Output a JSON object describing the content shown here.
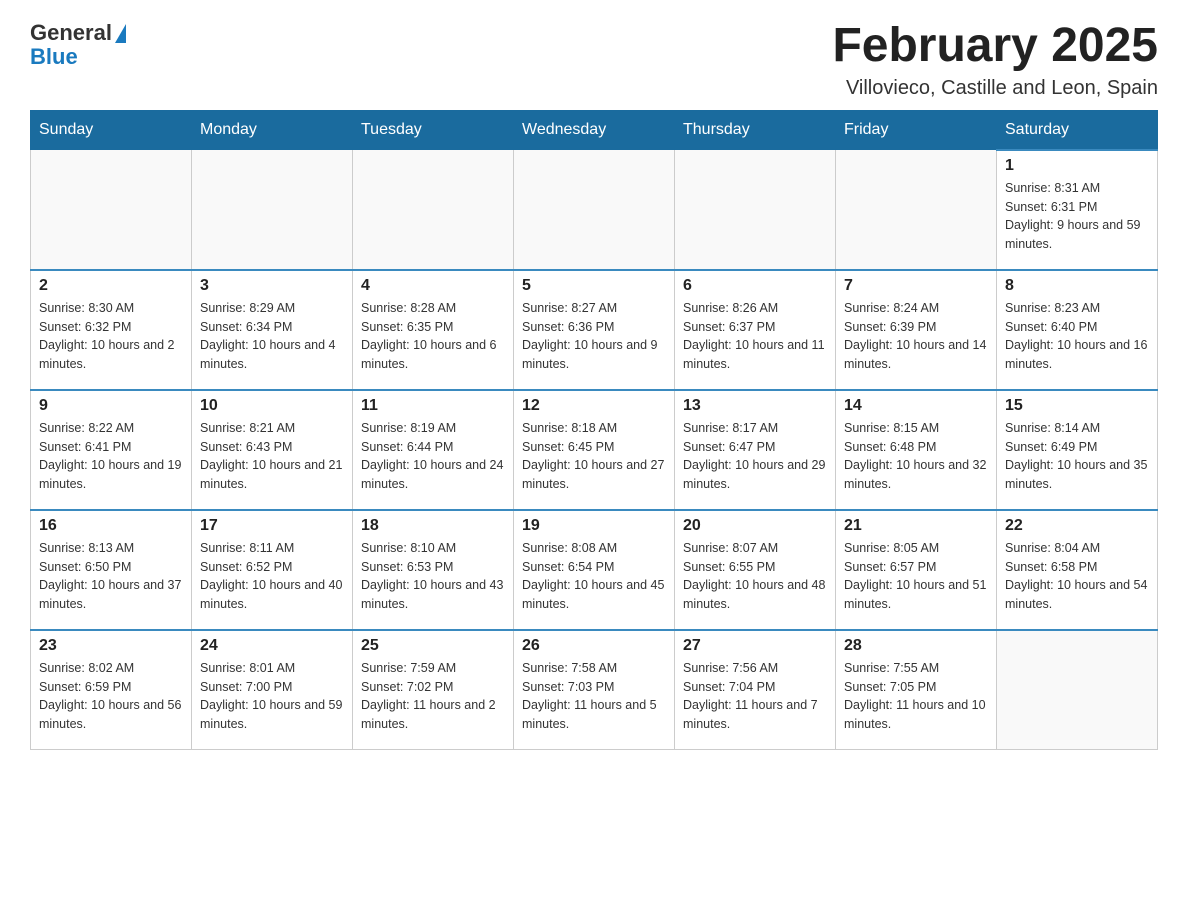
{
  "logo": {
    "text_general": "General",
    "text_blue": "Blue"
  },
  "header": {
    "month_title": "February 2025",
    "location": "Villovieco, Castille and Leon, Spain"
  },
  "days_of_week": [
    "Sunday",
    "Monday",
    "Tuesday",
    "Wednesday",
    "Thursday",
    "Friday",
    "Saturday"
  ],
  "weeks": [
    [
      {
        "day": "",
        "info": ""
      },
      {
        "day": "",
        "info": ""
      },
      {
        "day": "",
        "info": ""
      },
      {
        "day": "",
        "info": ""
      },
      {
        "day": "",
        "info": ""
      },
      {
        "day": "",
        "info": ""
      },
      {
        "day": "1",
        "info": "Sunrise: 8:31 AM\nSunset: 6:31 PM\nDaylight: 9 hours and 59 minutes."
      }
    ],
    [
      {
        "day": "2",
        "info": "Sunrise: 8:30 AM\nSunset: 6:32 PM\nDaylight: 10 hours and 2 minutes."
      },
      {
        "day": "3",
        "info": "Sunrise: 8:29 AM\nSunset: 6:34 PM\nDaylight: 10 hours and 4 minutes."
      },
      {
        "day": "4",
        "info": "Sunrise: 8:28 AM\nSunset: 6:35 PM\nDaylight: 10 hours and 6 minutes."
      },
      {
        "day": "5",
        "info": "Sunrise: 8:27 AM\nSunset: 6:36 PM\nDaylight: 10 hours and 9 minutes."
      },
      {
        "day": "6",
        "info": "Sunrise: 8:26 AM\nSunset: 6:37 PM\nDaylight: 10 hours and 11 minutes."
      },
      {
        "day": "7",
        "info": "Sunrise: 8:24 AM\nSunset: 6:39 PM\nDaylight: 10 hours and 14 minutes."
      },
      {
        "day": "8",
        "info": "Sunrise: 8:23 AM\nSunset: 6:40 PM\nDaylight: 10 hours and 16 minutes."
      }
    ],
    [
      {
        "day": "9",
        "info": "Sunrise: 8:22 AM\nSunset: 6:41 PM\nDaylight: 10 hours and 19 minutes."
      },
      {
        "day": "10",
        "info": "Sunrise: 8:21 AM\nSunset: 6:43 PM\nDaylight: 10 hours and 21 minutes."
      },
      {
        "day": "11",
        "info": "Sunrise: 8:19 AM\nSunset: 6:44 PM\nDaylight: 10 hours and 24 minutes."
      },
      {
        "day": "12",
        "info": "Sunrise: 8:18 AM\nSunset: 6:45 PM\nDaylight: 10 hours and 27 minutes."
      },
      {
        "day": "13",
        "info": "Sunrise: 8:17 AM\nSunset: 6:47 PM\nDaylight: 10 hours and 29 minutes."
      },
      {
        "day": "14",
        "info": "Sunrise: 8:15 AM\nSunset: 6:48 PM\nDaylight: 10 hours and 32 minutes."
      },
      {
        "day": "15",
        "info": "Sunrise: 8:14 AM\nSunset: 6:49 PM\nDaylight: 10 hours and 35 minutes."
      }
    ],
    [
      {
        "day": "16",
        "info": "Sunrise: 8:13 AM\nSunset: 6:50 PM\nDaylight: 10 hours and 37 minutes."
      },
      {
        "day": "17",
        "info": "Sunrise: 8:11 AM\nSunset: 6:52 PM\nDaylight: 10 hours and 40 minutes."
      },
      {
        "day": "18",
        "info": "Sunrise: 8:10 AM\nSunset: 6:53 PM\nDaylight: 10 hours and 43 minutes."
      },
      {
        "day": "19",
        "info": "Sunrise: 8:08 AM\nSunset: 6:54 PM\nDaylight: 10 hours and 45 minutes."
      },
      {
        "day": "20",
        "info": "Sunrise: 8:07 AM\nSunset: 6:55 PM\nDaylight: 10 hours and 48 minutes."
      },
      {
        "day": "21",
        "info": "Sunrise: 8:05 AM\nSunset: 6:57 PM\nDaylight: 10 hours and 51 minutes."
      },
      {
        "day": "22",
        "info": "Sunrise: 8:04 AM\nSunset: 6:58 PM\nDaylight: 10 hours and 54 minutes."
      }
    ],
    [
      {
        "day": "23",
        "info": "Sunrise: 8:02 AM\nSunset: 6:59 PM\nDaylight: 10 hours and 56 minutes."
      },
      {
        "day": "24",
        "info": "Sunrise: 8:01 AM\nSunset: 7:00 PM\nDaylight: 10 hours and 59 minutes."
      },
      {
        "day": "25",
        "info": "Sunrise: 7:59 AM\nSunset: 7:02 PM\nDaylight: 11 hours and 2 minutes."
      },
      {
        "day": "26",
        "info": "Sunrise: 7:58 AM\nSunset: 7:03 PM\nDaylight: 11 hours and 5 minutes."
      },
      {
        "day": "27",
        "info": "Sunrise: 7:56 AM\nSunset: 7:04 PM\nDaylight: 11 hours and 7 minutes."
      },
      {
        "day": "28",
        "info": "Sunrise: 7:55 AM\nSunset: 7:05 PM\nDaylight: 11 hours and 10 minutes."
      },
      {
        "day": "",
        "info": ""
      }
    ]
  ]
}
